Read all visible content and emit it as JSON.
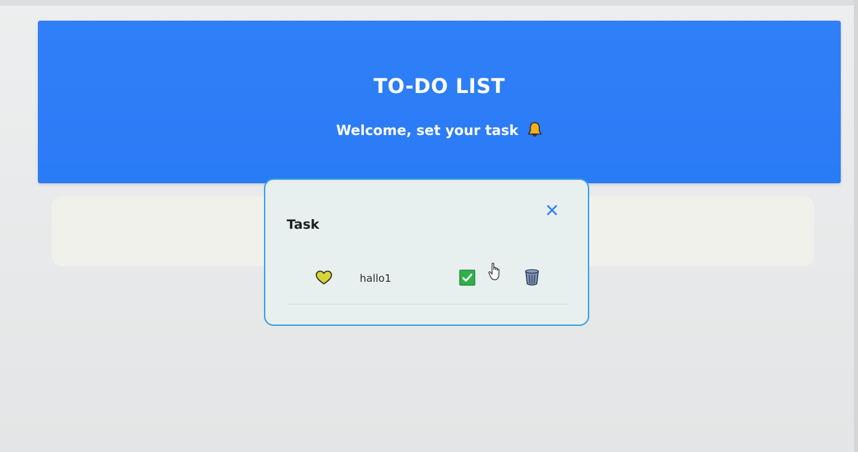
{
  "header": {
    "title": "TO-DO LIST",
    "subtitle": "Welcome, set your task",
    "bell_icon": "bell-icon"
  },
  "modal": {
    "title": "Task",
    "close_icon": "close-icon"
  },
  "tasks": [
    {
      "text": "hallo1",
      "favorite_icon": "heart-icon",
      "done_icon": "checkbox-checked-icon",
      "delete_icon": "trash-icon"
    }
  ],
  "colors": {
    "header_bg": "#2f7ff8",
    "modal_border": "#3aa2e0",
    "close": "#2f7ff8",
    "heart": "#d6d43b",
    "check": "#2eb04a",
    "trash": "#7a8fb0"
  }
}
